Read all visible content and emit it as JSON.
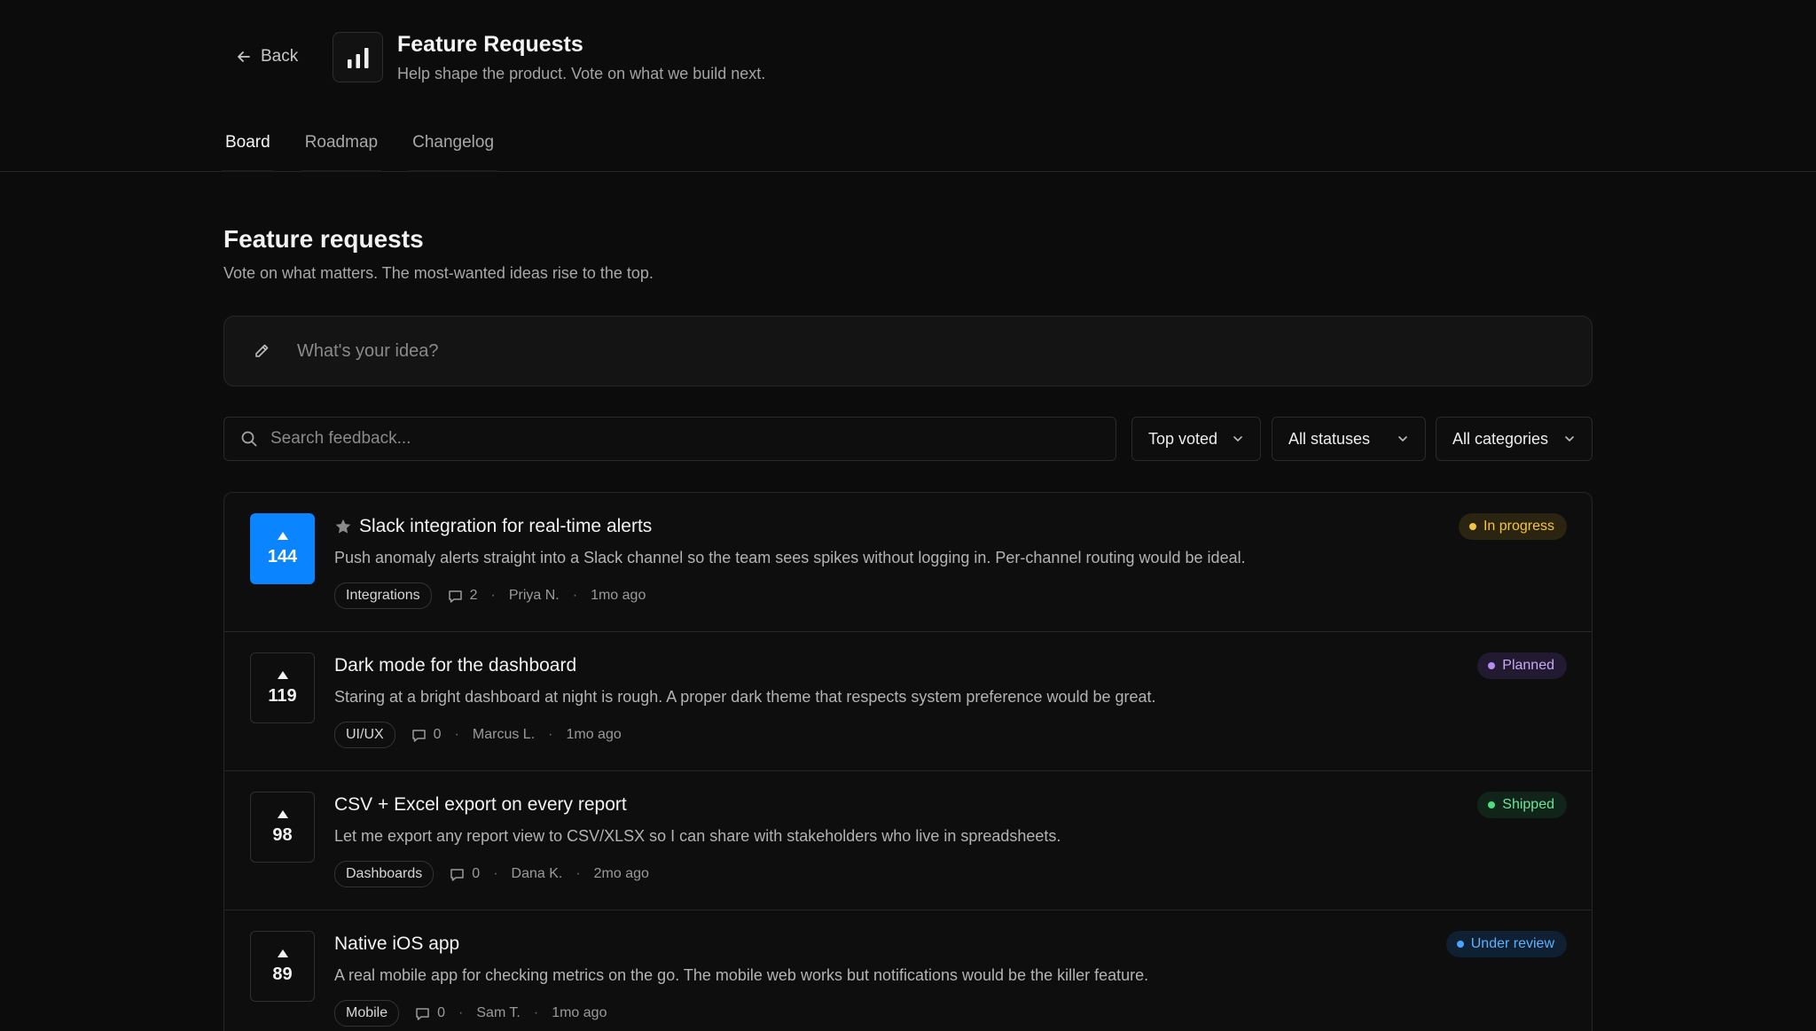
{
  "header": {
    "back_label": "Back",
    "title": "Feature Requests",
    "subtitle": "Help shape the product. Vote on what we build next.",
    "logo_icon": "bar-chart-icon"
  },
  "tabs": [
    {
      "label": "Board",
      "active": true
    },
    {
      "label": "Roadmap",
      "active": false
    },
    {
      "label": "Changelog",
      "active": false
    }
  ],
  "main": {
    "title": "Feature requests",
    "subtitle": "Vote on what matters. The most-wanted ideas rise to the top.",
    "idea_placeholder": "What's your idea?",
    "search_placeholder": "Search feedback..."
  },
  "filters": {
    "sort": "Top voted",
    "status": "All statuses",
    "category": "All categories"
  },
  "colors": {
    "accent": "#0a84ff",
    "in_progress": "#f5c542",
    "planned": "#b48cf2",
    "shipped": "#4ade80",
    "under_review": "#4aa3ff"
  },
  "requests": [
    {
      "votes": "144",
      "voted": true,
      "starred": true,
      "title": "Slack integration for real-time alerts",
      "description": "Push anomaly alerts straight into a Slack channel so the team sees spikes without logging in. Per-channel routing would be ideal.",
      "tag": "Integrations",
      "comments": "2",
      "author": "Priya N.",
      "time": "1mo ago",
      "status": "In progress"
    },
    {
      "votes": "119",
      "voted": false,
      "starred": false,
      "title": "Dark mode for the dashboard",
      "description": "Staring at a bright dashboard at night is rough. A proper dark theme that respects system preference would be great.",
      "tag": "UI/UX",
      "comments": "0",
      "author": "Marcus L.",
      "time": "1mo ago",
      "status": "Planned"
    },
    {
      "votes": "98",
      "voted": false,
      "starred": false,
      "title": "CSV + Excel export on every report",
      "description": "Let me export any report view to CSV/XLSX so I can share with stakeholders who live in spreadsheets.",
      "tag": "Dashboards",
      "comments": "0",
      "author": "Dana K.",
      "time": "2mo ago",
      "status": "Shipped"
    },
    {
      "votes": "89",
      "voted": false,
      "starred": false,
      "title": "Native iOS app",
      "description": "A real mobile app for checking metrics on the go. The mobile web works but notifications would be the killer feature.",
      "tag": "Mobile",
      "comments": "0",
      "author": "Sam T.",
      "time": "1mo ago",
      "status": "Under review"
    }
  ]
}
